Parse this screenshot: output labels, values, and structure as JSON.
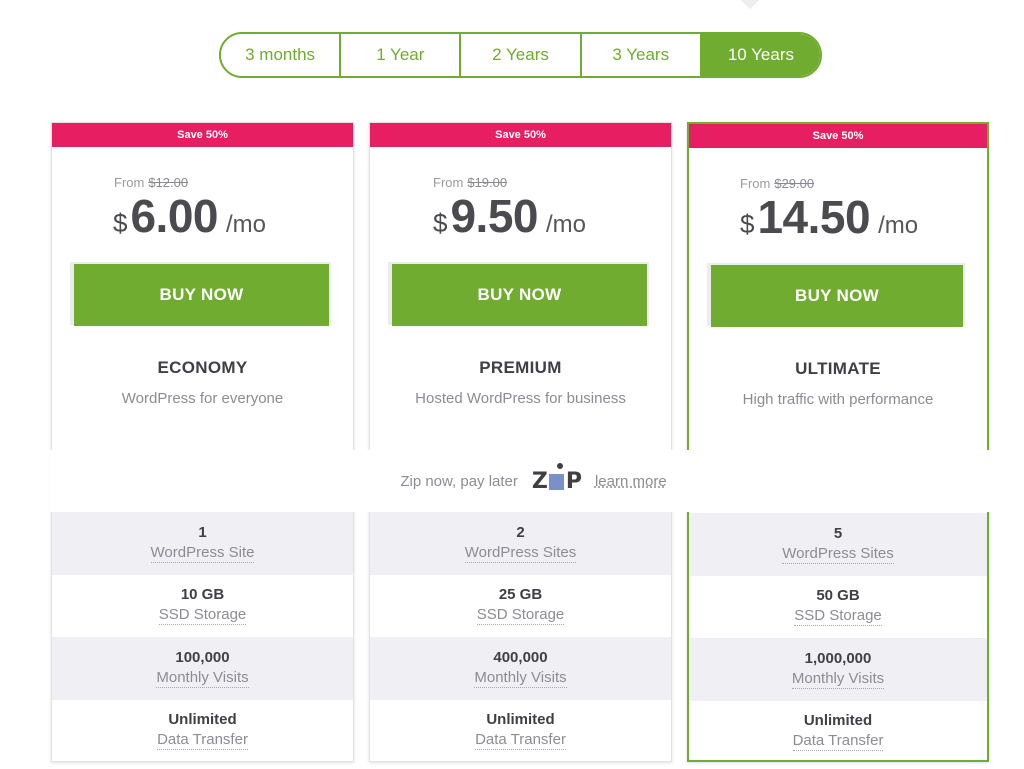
{
  "billing_terms": {
    "options": [
      "3 months",
      "1 Year",
      "2 Years",
      "3 Years",
      "10 Years"
    ],
    "selected": "10 Years"
  },
  "colors": {
    "accent_green": "#6fac2f",
    "ribbon_pink": "#e81e63",
    "text_dark": "#3f3f44",
    "text_muted": "#8c8c92"
  },
  "plans": [
    {
      "ribbon": "Save 50%",
      "from_label": "From",
      "original_price": "$12.00",
      "currency": "$",
      "price": "6.00",
      "period": "/mo",
      "buy_label": "BUY NOW",
      "name": "ECONOMY",
      "description": "WordPress for everyone",
      "highlighted": false,
      "features": [
        {
          "value": "1",
          "label": "WordPress Site"
        },
        {
          "value": "10 GB",
          "label": "SSD Storage"
        },
        {
          "value": "100,000",
          "label": "Monthly Visits"
        },
        {
          "value": "Unlimited",
          "label": "Data Transfer"
        }
      ]
    },
    {
      "ribbon": "Save 50%",
      "from_label": "From",
      "original_price": "$19.00",
      "currency": "$",
      "price": "9.50",
      "period": "/mo",
      "buy_label": "BUY NOW",
      "name": "PREMIUM",
      "description": "Hosted WordPress for business",
      "highlighted": false,
      "features": [
        {
          "value": "2",
          "label": "WordPress Sites"
        },
        {
          "value": "25 GB",
          "label": "SSD Storage"
        },
        {
          "value": "400,000",
          "label": "Monthly Visits"
        },
        {
          "value": "Unlimited",
          "label": "Data Transfer"
        }
      ]
    },
    {
      "ribbon": "Save 50%",
      "from_label": "From",
      "original_price": "$29.00",
      "currency": "$",
      "price": "14.50",
      "period": "/mo",
      "buy_label": "BUY NOW",
      "name": "ULTIMATE",
      "description": "High traffic with performance",
      "highlighted": true,
      "features": [
        {
          "value": "5",
          "label": "WordPress Sites"
        },
        {
          "value": "50 GB",
          "label": "SSD Storage"
        },
        {
          "value": "1,000,000",
          "label": "Monthly Visits"
        },
        {
          "value": "Unlimited",
          "label": "Data Transfer"
        }
      ]
    }
  ],
  "zip": {
    "text": "Zip now, pay later",
    "logo_left": "Z",
    "logo_right": "P",
    "learn_more": "learn more"
  }
}
